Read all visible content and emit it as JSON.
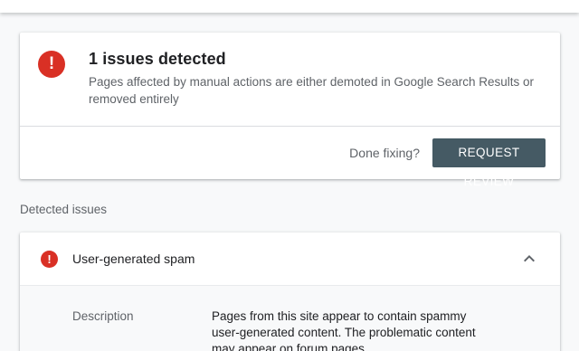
{
  "summary": {
    "icon": "exclamation-circle-icon",
    "icon_glyph": "!",
    "title": "1 issues detected",
    "description": "Pages affected by manual actions are either demoted in Google Search Results or removed entirely",
    "done_label": "Done fixing?",
    "request_review_label": "REQUEST REVIEW"
  },
  "section": {
    "label": "Detected issues"
  },
  "issue": {
    "icon": "exclamation-circle-icon",
    "icon_glyph": "!",
    "title": "User-generated spam",
    "expanded": true,
    "description_label": "Description",
    "description_text": "Pages from this site appear to contain spammy user-generated content. The problematic content may appear on forum pages"
  },
  "colors": {
    "alert": "#d93025",
    "button": "#455a64",
    "secondary_text": "#5f6368"
  }
}
